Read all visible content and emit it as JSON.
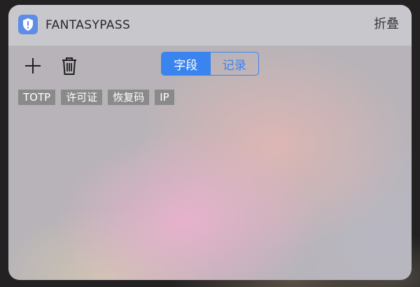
{
  "header": {
    "app_title": "FANTASYPASS",
    "collapse_label": "折叠",
    "icon": "shield-exclamation-icon",
    "accent_color": "#5e8de8"
  },
  "toolbar": {
    "add_icon": "plus-icon",
    "delete_icon": "trash-icon"
  },
  "segmented": {
    "options": [
      {
        "label": "字段",
        "selected": true
      },
      {
        "label": "记录",
        "selected": false
      }
    ],
    "accent_color": "#3a84f0"
  },
  "tags": [
    {
      "label": "TOTP"
    },
    {
      "label": "许可证"
    },
    {
      "label": "恢复码"
    },
    {
      "label": "IP"
    }
  ]
}
